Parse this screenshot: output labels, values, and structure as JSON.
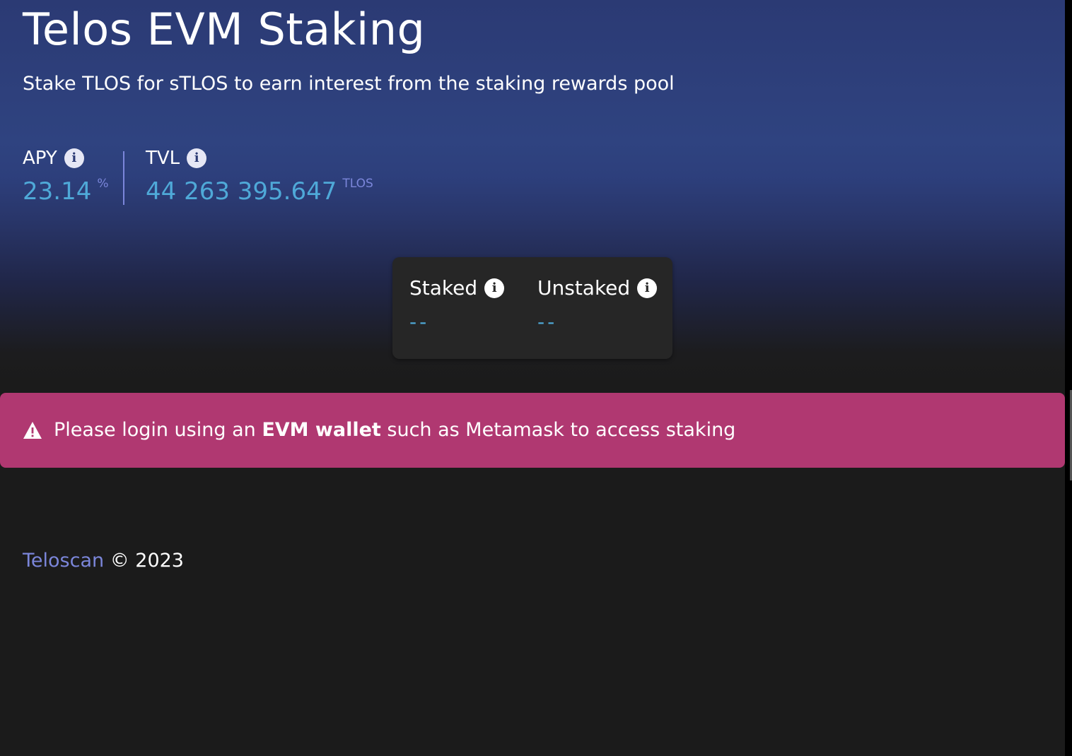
{
  "header": {
    "title": "Telos EVM Staking",
    "subtitle": "Stake TLOS for sTLOS to earn interest from the staking rewards pool"
  },
  "stats": {
    "apy": {
      "label": "APY",
      "value": "23.14",
      "unit": "%",
      "icon": "info-icon"
    },
    "tvl": {
      "label": "TVL",
      "value": "44 263 395.647",
      "unit": "TLOS",
      "icon": "info-icon"
    }
  },
  "balance_card": {
    "staked": {
      "label": "Staked",
      "value": "--",
      "icon": "info-icon"
    },
    "unstaked": {
      "label": "Unstaked",
      "value": "--",
      "icon": "info-icon"
    }
  },
  "alert": {
    "icon": "warning-icon",
    "text_before": "Please login using an ",
    "text_bold": "EVM wallet",
    "text_after": " such as Metamask to access staking"
  },
  "footer": {
    "link": "Teloscan",
    "copyright": " © 2023"
  },
  "colors": {
    "accent": "#4fa9d8",
    "secondary": "#7b86da",
    "alert_bg": "#b03871",
    "background": "#1b1b1b",
    "hero_blue": "#2f4380"
  }
}
